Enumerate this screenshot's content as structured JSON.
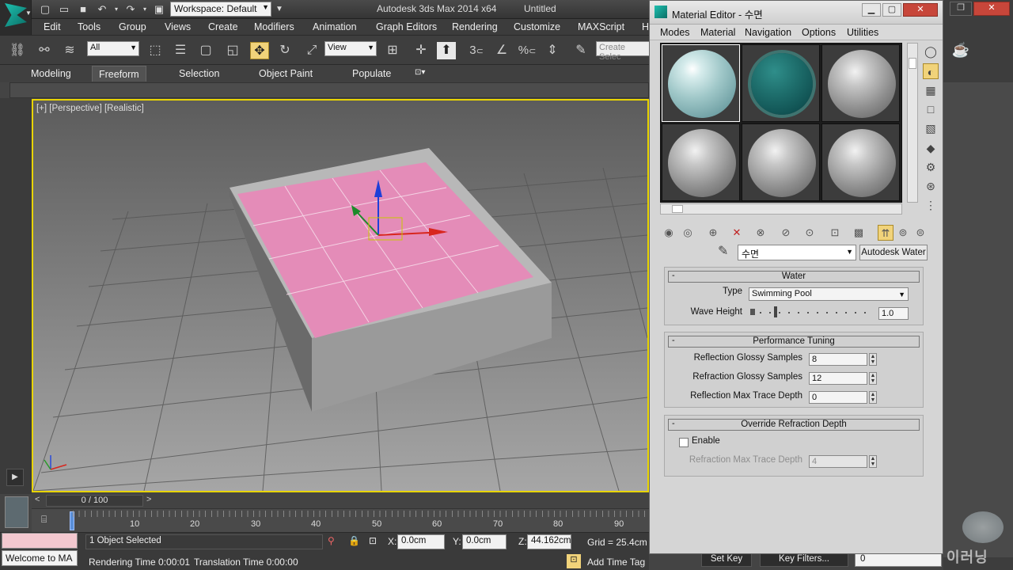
{
  "app": {
    "workspace": "Workspace: Default",
    "title": "Autodesk 3ds Max  2014 x64",
    "doc": "Untitled"
  },
  "menu": [
    "Edit",
    "Tools",
    "Group",
    "Views",
    "Create",
    "Modifiers",
    "Animation",
    "Graph Editors",
    "Rendering",
    "Customize",
    "MAXScript",
    "H"
  ],
  "toolbar": {
    "filter": "All",
    "refcoord": "View",
    "create_sel": "Create Selec",
    "snap_num": "3",
    "pct": "%"
  },
  "ribbon_tabs": [
    "Modeling",
    "Freeform",
    "Selection",
    "Object Paint",
    "Populate"
  ],
  "ribbon_active": "Freeform",
  "viewport": {
    "label": "[+] [Perspective] [Realistic]"
  },
  "timeline": {
    "frame": "0 / 100",
    "ticks": [
      "10",
      "20",
      "30",
      "40",
      "50",
      "60",
      "70",
      "80",
      "90"
    ]
  },
  "status": {
    "selected": "1 Object Selected",
    "x_label": "X:",
    "x": "0.0cm",
    "y_label": "Y:",
    "y": "0.0cm",
    "z_label": "Z:",
    "z": "44.162cm",
    "grid": "Grid = 25.4cm",
    "render_time": "Rendering Time  0:00:01",
    "trans_time": "Translation Time  0:00:00",
    "welcome": "Welcome to MA",
    "add_time_tag": "Add Time Tag",
    "set_key": "Set Key",
    "key_filters": "Key Filters...",
    "frame_field": "0"
  },
  "material_editor": {
    "title": "Material Editor - 수면",
    "menu": [
      "Modes",
      "Material",
      "Navigation",
      "Options",
      "Utilities"
    ],
    "material_name": "수면",
    "material_type": "Autodesk Water",
    "water": {
      "header": "Water",
      "type_label": "Type",
      "type_value": "Swimming Pool",
      "wave_label": "Wave Height",
      "wave_value": "1.0",
      "wave_level": 0.2
    },
    "performance": {
      "header": "Performance Tuning",
      "rows": [
        {
          "label": "Reflection Glossy Samples",
          "value": "8"
        },
        {
          "label": "Refraction Glossy Samples",
          "value": "12"
        },
        {
          "label": "Reflection Max Trace Depth",
          "value": "0"
        }
      ]
    },
    "override": {
      "header": "Override Refraction Depth",
      "enable_label": "Enable",
      "depth_label": "Refraction Max Trace Depth",
      "depth_value": "4"
    }
  },
  "watermark": "이러닝"
}
